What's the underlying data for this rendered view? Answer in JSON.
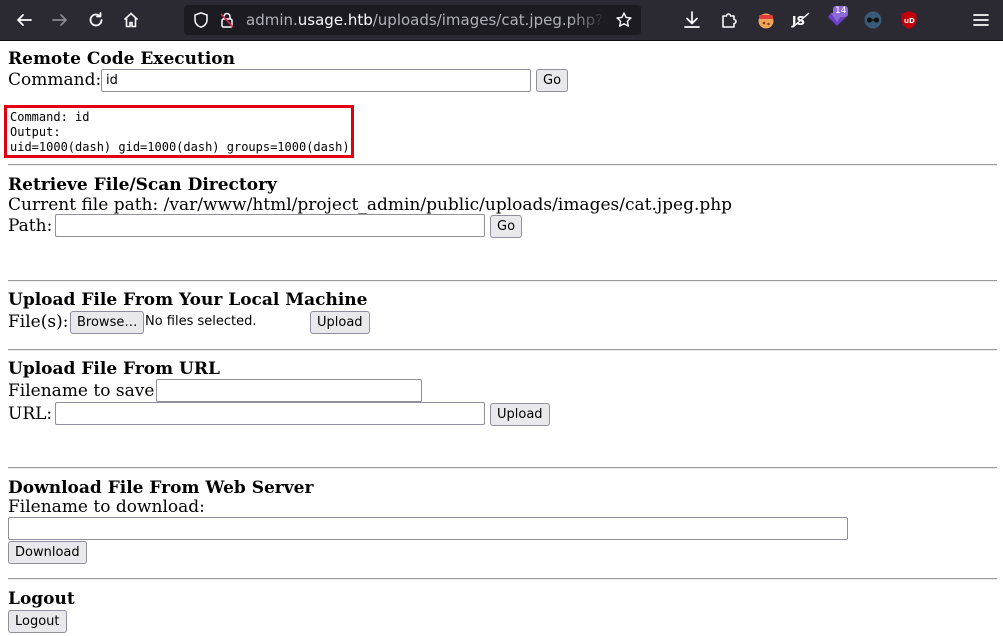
{
  "browser": {
    "url_prefix": "admin.",
    "url_domain": "usage.htb",
    "url_path": "/uploads/images/cat.jpeg.php?command=id",
    "extension_badge": "14"
  },
  "rce": {
    "heading": "Remote Code Execution",
    "command_label": "Command:",
    "command_value": "id",
    "go_label": "Go",
    "output_command_line": "Command: id",
    "output_label": "Output:",
    "output_result": "uid=1000(dash) gid=1000(dash) groups=1000(dash)"
  },
  "retrieve": {
    "heading": "Retrieve File/Scan Directory",
    "current_path": "Current file path: /var/www/html/project_admin/public/uploads/images/cat.jpeg.php",
    "path_label": "Path:",
    "path_value": "",
    "go_label": "Go"
  },
  "upload_local": {
    "heading": "Upload File From Your Local Machine",
    "files_label": "File(s):",
    "browse_label": "Browse…",
    "no_files_text": "No files selected.",
    "upload_label": "Upload"
  },
  "upload_url": {
    "heading": "Upload File From URL",
    "filename_label": "Filename to save:",
    "filename_value": "",
    "url_label": "URL:",
    "url_value": "",
    "upload_label": "Upload"
  },
  "download": {
    "heading": "Download File From Web Server",
    "filename_label": "Filename to download:",
    "filename_value": "",
    "download_label": "Download"
  },
  "logout": {
    "heading": "Logout",
    "button_label": "Logout"
  },
  "icons": {
    "back": "arrow-left-icon",
    "forward": "arrow-right-icon",
    "reload": "reload-icon",
    "home": "home-icon",
    "shield": "shield-icon",
    "lock": "lock-icon",
    "bookmark": "star-icon",
    "download": "download-icon",
    "extensions": "puzzle-icon",
    "menu": "hamburger-menu-icon"
  }
}
